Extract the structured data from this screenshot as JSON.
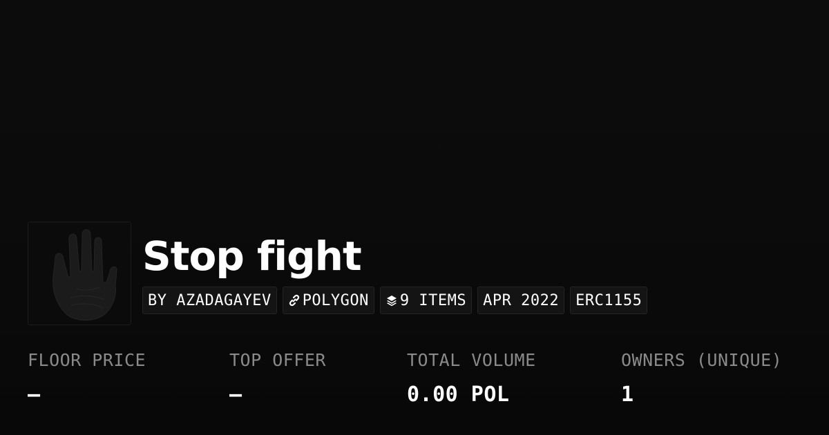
{
  "collection": {
    "name": "Stop fight",
    "thumbnail_icon": "hand-print-icon"
  },
  "tags": [
    {
      "label": "BY AZADAGAYEV",
      "icon": ""
    },
    {
      "label": "POLYGON",
      "icon": "chain-link-icon"
    },
    {
      "label": "9 ITEMS",
      "icon": "layers-icon"
    },
    {
      "label": "APR 2022",
      "icon": ""
    },
    {
      "label": "ERC1155",
      "icon": ""
    }
  ],
  "stats": [
    {
      "label": "FLOOR PRICE",
      "value": "–"
    },
    {
      "label": "TOP OFFER",
      "value": "–"
    },
    {
      "label": "TOTAL VOLUME",
      "value": "0.00 POL"
    },
    {
      "label": "OWNERS (UNIQUE)",
      "value": "1"
    }
  ],
  "colors": {
    "background": "#0a0a0a",
    "text": "#ffffff",
    "muted": "#8a8a8a",
    "tag_bg": "#141414",
    "tag_border": "#242424"
  }
}
